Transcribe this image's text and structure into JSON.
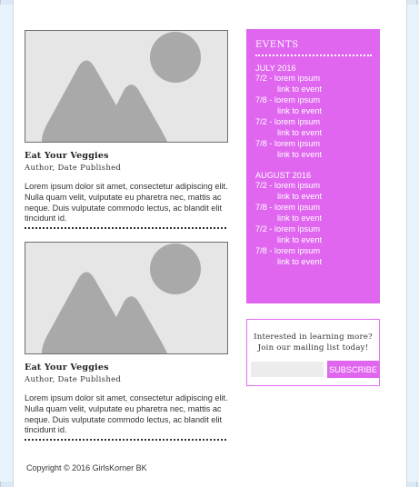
{
  "posts": [
    {
      "title": "Eat Your Veggies",
      "meta": "Author, Date Published",
      "body": "Lorem ipsum dolor sit amet, consectetur adipiscing elit. Nulla quam velit, vulputate eu pharetra nec, mattis ac neque. Duis vulputate commodo lectus, ac blandit elit tincidunt id.",
      "image_icon": "image-placeholder-icon"
    },
    {
      "title": "Eat Your Veggies",
      "meta": "Author, Date Published",
      "body": "Lorem ipsum dolor sit amet, consectetur adipiscing elit. Nulla quam velit, vulputate eu pharetra nec, mattis ac neque. Duis vulputate commodo lectus, ac blandit elit tincidunt id.",
      "image_icon": "image-placeholder-icon"
    }
  ],
  "events": {
    "title": "EVENTS",
    "months": [
      {
        "name": "JULY 2016",
        "items": [
          {
            "date": "7/2 - lorem ipsum",
            "link": "link to event"
          },
          {
            "date": "7/8 - lorem ipsum",
            "link": "link to event"
          },
          {
            "date": "7/2 - lorem ipsum",
            "link": "link to event"
          },
          {
            "date": "7/8 - lorem ipsum",
            "link": "link to event"
          }
        ]
      },
      {
        "name": "AUGUST 2016",
        "items": [
          {
            "date": "7/2 - lorem ipsum",
            "link": "link to event"
          },
          {
            "date": "7/8 - lorem ipsum",
            "link": "link to event"
          },
          {
            "date": "7/2 - lorem ipsum",
            "link": "link to event"
          },
          {
            "date": "7/8 - lorem ipsum",
            "link": "link to event"
          }
        ]
      }
    ]
  },
  "mailing": {
    "line1": "Interested in learning more?",
    "line2": "Join our mailing list today!",
    "input_value": "",
    "button_label": "SUBSCRIBE"
  },
  "footer": {
    "copyright": "Copyright © 2016 GirlsKorner BK"
  },
  "colors": {
    "accent": "#e066f0",
    "page_bg": "#e9f3fb",
    "placeholder_bg": "#e6e6e6",
    "placeholder_shape": "#a9a9a9"
  }
}
